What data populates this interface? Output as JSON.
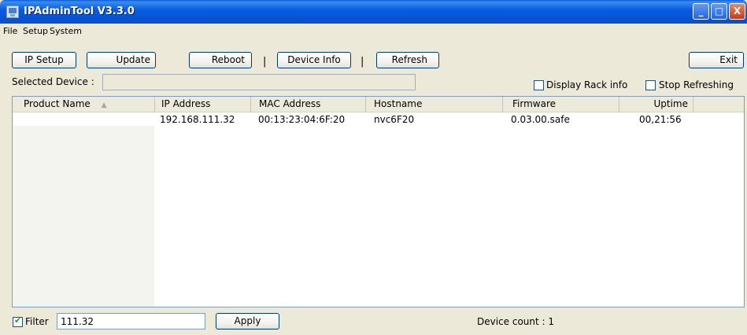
{
  "window": {
    "title": "IPAdminTool V3.3.0",
    "controls": [
      "_",
      "□",
      "X"
    ]
  },
  "menu": [
    "File",
    "Setup",
    "System"
  ],
  "toolbar": {
    "ip_setup": "IP Setup",
    "update": "Update",
    "reboot": "Reboot",
    "device_info": "Device Info",
    "refresh": "Refresh",
    "exit": "Exit",
    "separator": "|"
  },
  "selected_device": {
    "label": "Selected Device :",
    "value": ""
  },
  "options": {
    "display_rack_info": {
      "label": "Display Rack info",
      "checked": false
    },
    "stop_refreshing": {
      "label": "Stop Refreshing",
      "checked": false
    }
  },
  "table": {
    "columns": [
      "Product Name",
      "IP Address",
      "MAC Address",
      "Hostname",
      "Firmware",
      "Uptime"
    ],
    "sort_indicator": "▲",
    "rows": [
      {
        "product_name": "",
        "ip": "192.168.111.32",
        "mac": "00:13:23:04:6F:20",
        "hostname": "nvc6F20",
        "firmware": "0.03.00.safe",
        "uptime": "00,21:56"
      }
    ]
  },
  "footer": {
    "filter_label": "Filter",
    "filter_checked": true,
    "filter_value": "111.32",
    "apply": "Apply",
    "device_count": "Device count : 1"
  }
}
